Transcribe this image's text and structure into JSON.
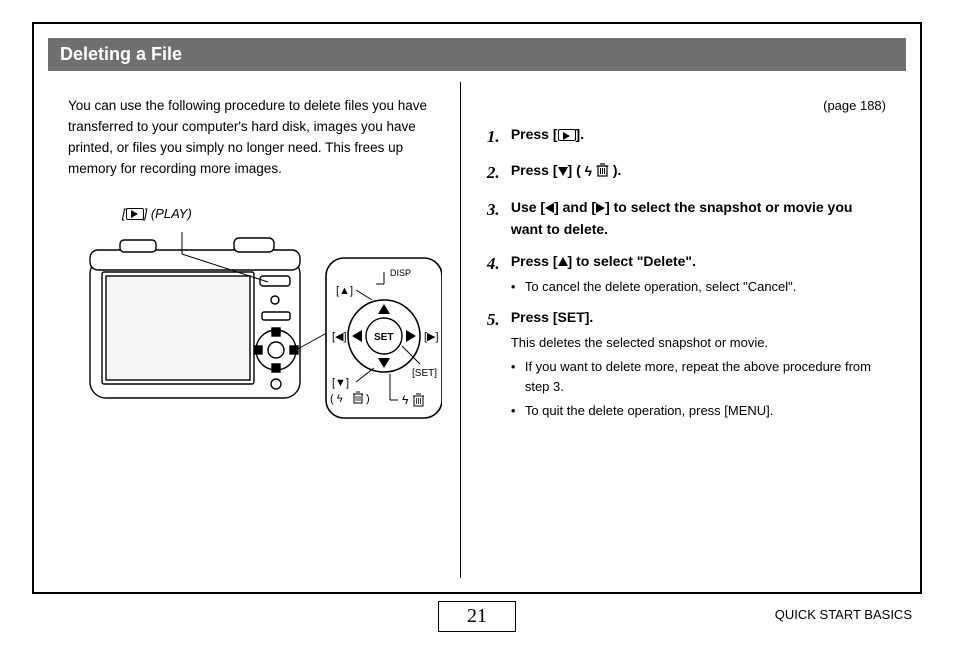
{
  "header": {
    "title": "Deleting a File"
  },
  "left": {
    "intro": "You can use the following procedure to delete files you have transferred to your computer's hard disk, images you have printed, or files you simply no longer need. This frees up memory for recording more images.",
    "illus_label_suffix": "] (PLAY)",
    "illus_label_prefix": "[",
    "diagram": {
      "top_label": "DISP",
      "up": "[▲]",
      "left": "[◀]",
      "right": "[▶]",
      "down": "[▼]",
      "down_icons": "( ⚡ 🗑 )",
      "set": "SET",
      "set_label": "[SET]"
    }
  },
  "right": {
    "page_ref": "(page 188)",
    "steps": [
      {
        "num": "1.",
        "title_pre": "Press [",
        "title_post": "].",
        "icon": "play"
      },
      {
        "num": "2.",
        "title_pre": "Press [",
        "title_mid": "] ( ",
        "title_post": " ).",
        "icon": "down",
        "icon2": "flash-trash"
      },
      {
        "num": "3.",
        "title_pre": "Use [",
        "title_mid1": "] and [",
        "title_mid2": "] to select the snapshot or movie you want to delete.",
        "iconA": "left",
        "iconB": "right"
      },
      {
        "num": "4.",
        "title_pre": "Press [",
        "title_post": "] to select \"Delete\".",
        "icon": "up",
        "bullets": [
          "To cancel the delete operation, select \"Cancel\"."
        ]
      },
      {
        "num": "5.",
        "title": "Press [SET].",
        "sub": "This deletes the selected snapshot or movie.",
        "bullets": [
          "If you want to delete more, repeat the above procedure from step 3.",
          "To quit the delete operation, press [MENU]."
        ]
      }
    ]
  },
  "footer": {
    "page_num": "21",
    "section": "QUICK START BASICS"
  }
}
